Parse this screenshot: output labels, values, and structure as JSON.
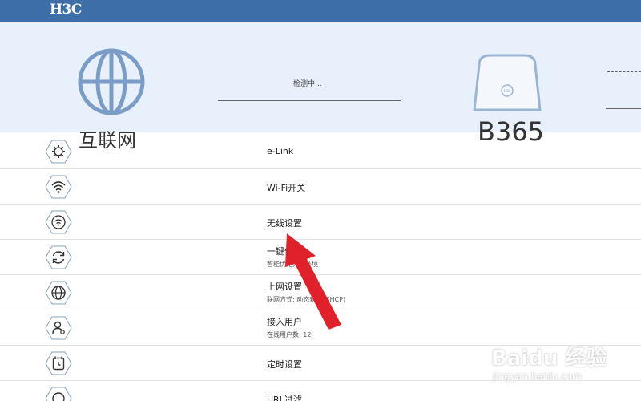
{
  "header": {
    "brand": "H3C"
  },
  "status": {
    "internet_label": "互联网",
    "detecting_text": "检测中...",
    "router_model": "B365",
    "router_badge": "H3C"
  },
  "menu": [
    {
      "title": "e-Link",
      "subtitle": "",
      "icon": "gear-icon"
    },
    {
      "title": "Wi-Fi开关",
      "subtitle": "",
      "icon": "wifi-icon"
    },
    {
      "title": "无线设置",
      "subtitle": "",
      "icon": "wireless-settings-icon"
    },
    {
      "title": "一键优化",
      "subtitle": "智能优化无线环境",
      "icon": "refresh-icon"
    },
    {
      "title": "上网设置",
      "subtitle": "联网方式: 动态获取(DHCP)",
      "icon": "globe-icon"
    },
    {
      "title": "接入用户",
      "subtitle": "在线用户数: 12",
      "icon": "user-icon"
    },
    {
      "title": "定时设置",
      "subtitle": "",
      "icon": "timer-icon"
    },
    {
      "title": "URL过滤",
      "subtitle": "",
      "icon": "filter-icon"
    }
  ],
  "watermark": {
    "main": "Baidu 经验",
    "sub": "jingyan.baidu.com"
  },
  "colors": {
    "header": "#3e6ea8",
    "status_bg": "#e8f1fb",
    "arrow": "#e0202a"
  }
}
